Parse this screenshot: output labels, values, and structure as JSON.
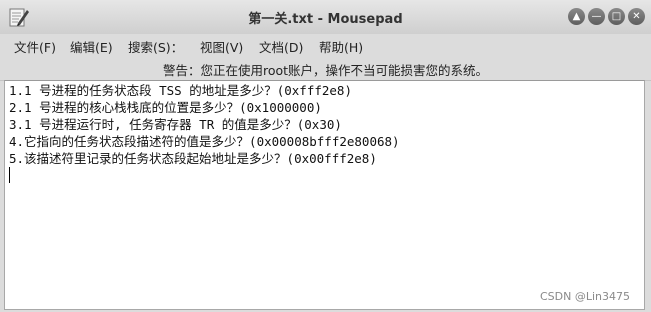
{
  "window": {
    "title": "第一关.txt - Mousepad",
    "icon": "text-editor-icon",
    "controls": [
      "▲",
      "—",
      "□",
      "✕"
    ]
  },
  "menu": {
    "items": [
      "文件(F)",
      "编辑(E)",
      "搜索(S)：",
      "视图(V)",
      "文档(D)",
      "帮助(H)"
    ]
  },
  "warning": {
    "text": "警告：您正在使用root账户，操作不当可能损害您的系统。"
  },
  "editor": {
    "lines": [
      "1.1 号进程的任务状态段 TSS 的地址是多少？(0xfff2e8)",
      "2.1 号进程的核心栈栈底的位置是多少？(0x1000000)",
      "3.1 号进程运行时, 任务寄存器 TR 的值是多少？(0x30)",
      "4.它指向的任务状态段描述符的值是多少？(0x00008bfff2e80068)",
      "5.该描述符里记录的任务状态段起始地址是多少？(0x00fff2e8)"
    ]
  },
  "watermark": "CSDN @Lin3475"
}
